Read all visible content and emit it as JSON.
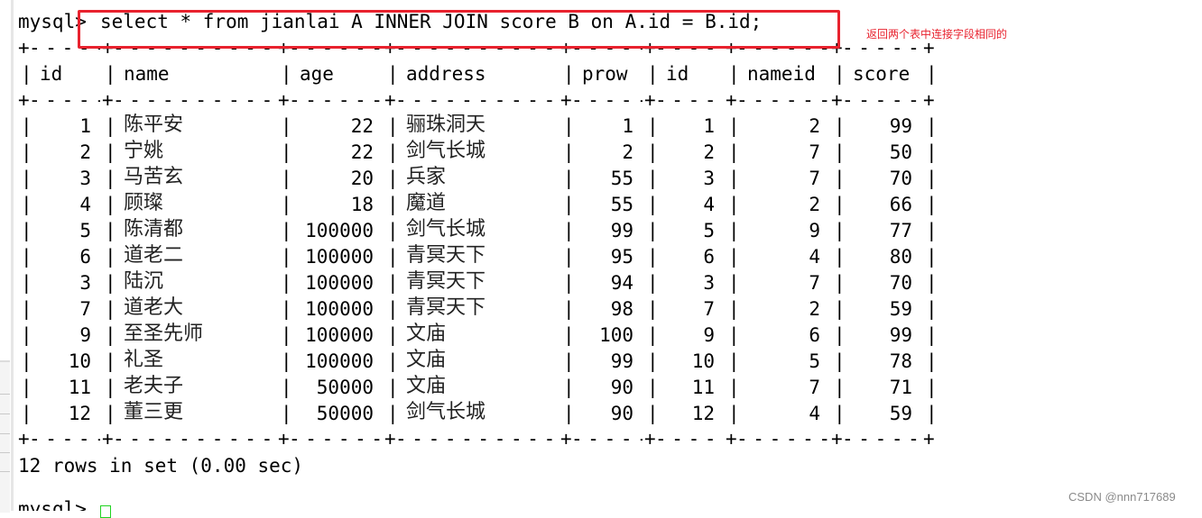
{
  "terminal": {
    "prompt": "mysql>",
    "command": "select * from jianlai A INNER JOIN score B on A.id = B.id;",
    "columns": [
      "id",
      "name",
      "age",
      "address",
      "prow",
      "id",
      "nameid",
      "score"
    ],
    "rows": [
      [
        "1",
        "陈平安",
        "22",
        "骊珠洞天",
        "1",
        "1",
        "2",
        "99"
      ],
      [
        "2",
        "宁姚",
        "22",
        "剑气长城",
        "2",
        "2",
        "7",
        "50"
      ],
      [
        "3",
        "马苦玄",
        "20",
        "兵家",
        "55",
        "3",
        "7",
        "70"
      ],
      [
        "4",
        "顾璨",
        "18",
        "魔道",
        "55",
        "4",
        "2",
        "66"
      ],
      [
        "5",
        "陈清都",
        "100000",
        "剑气长城",
        "99",
        "5",
        "9",
        "77"
      ],
      [
        "6",
        "道老二",
        "100000",
        "青冥天下",
        "95",
        "6",
        "4",
        "80"
      ],
      [
        "3",
        "陆沉",
        "100000",
        "青冥天下",
        "94",
        "3",
        "7",
        "70"
      ],
      [
        "7",
        "道老大",
        "100000",
        "青冥天下",
        "98",
        "7",
        "2",
        "59"
      ],
      [
        "9",
        "至圣先师",
        "100000",
        "文庙",
        "100",
        "9",
        "6",
        "99"
      ],
      [
        "10",
        "礼圣",
        "100000",
        "文庙",
        "99",
        "10",
        "5",
        "78"
      ],
      [
        "11",
        "老夫子",
        "50000",
        "文庙",
        "90",
        "11",
        "7",
        "71"
      ],
      [
        "12",
        "董三更",
        "50000",
        "剑气长城",
        "90",
        "12",
        "4",
        "59"
      ]
    ],
    "summary": "12 rows in set (0.00 sec)",
    "next_prompt": "mysql>"
  },
  "annotation": {
    "text": "返回两个表中连接字段相同的",
    "color": "#e8222e"
  },
  "highlight_color": "#e8222e",
  "watermark": "CSDN @nnn717689"
}
